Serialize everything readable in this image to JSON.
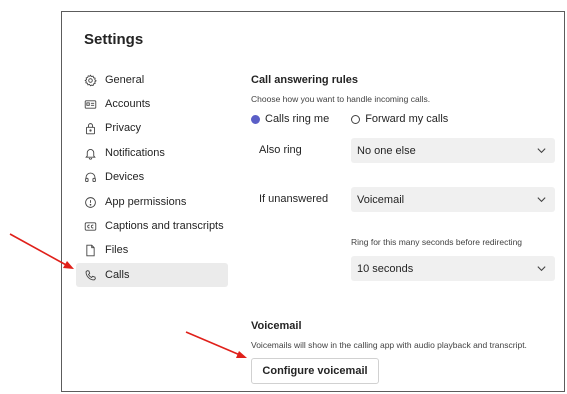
{
  "settings": {
    "title": "Settings",
    "nav": [
      {
        "label": "General",
        "icon": "gear-icon"
      },
      {
        "label": "Accounts",
        "icon": "id-card-icon"
      },
      {
        "label": "Privacy",
        "icon": "lock-icon"
      },
      {
        "label": "Notifications",
        "icon": "bell-icon"
      },
      {
        "label": "Devices",
        "icon": "headset-icon"
      },
      {
        "label": "App permissions",
        "icon": "shield-icon"
      },
      {
        "label": "Captions and transcripts",
        "icon": "cc-icon"
      },
      {
        "label": "Files",
        "icon": "file-icon"
      },
      {
        "label": "Calls",
        "icon": "phone-icon",
        "selected": true
      }
    ]
  },
  "call_rules": {
    "title": "Call answering rules",
    "description": "Choose how you want to handle incoming calls.",
    "option_ring": "Calls ring me",
    "option_forward": "Forward my calls",
    "selected_option": "Calls ring me",
    "also_ring_label": "Also ring",
    "also_ring_value": "No one else",
    "if_unanswered_label": "If unanswered",
    "if_unanswered_value": "Voicemail",
    "ring_seconds_label": "Ring for this many seconds before redirecting",
    "ring_seconds_value": "10 seconds"
  },
  "voicemail": {
    "title": "Voicemail",
    "description": "Voicemails will show in the calling app with audio playback and transcript.",
    "configure_button": "Configure voicemail"
  },
  "colors": {
    "accent": "#5b5fc7",
    "annotation_arrow": "#e0201a",
    "selected_nav_bg": "#ebebeb"
  }
}
